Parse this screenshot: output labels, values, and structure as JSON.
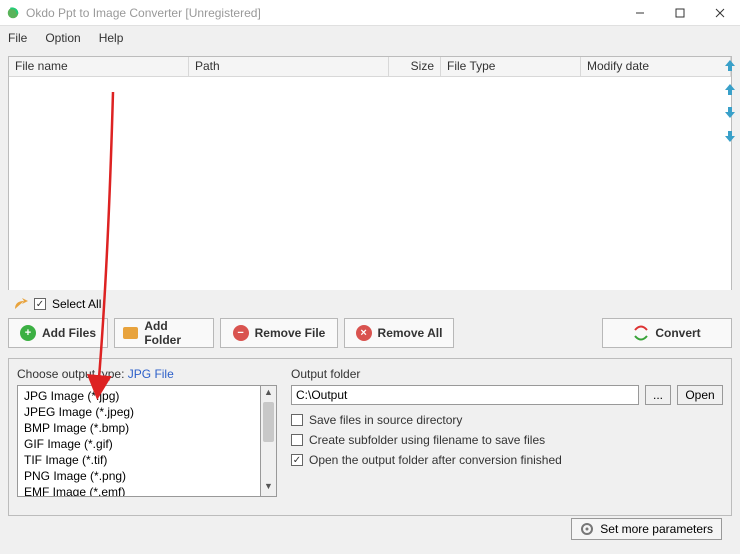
{
  "window": {
    "title": "Okdo Ppt to Image Converter [Unregistered]"
  },
  "menu": {
    "file": "File",
    "option": "Option",
    "help": "Help"
  },
  "table": {
    "cols": {
      "filename": "File name",
      "path": "Path",
      "size": "Size",
      "filetype": "File Type",
      "modify": "Modify date"
    }
  },
  "selectall": "Select All",
  "buttons": {
    "addfiles": "Add Files",
    "addfolder": "Add Folder",
    "removefile": "Remove File",
    "removeall": "Remove All",
    "convert": "Convert"
  },
  "output": {
    "choose_label": "Choose output type:",
    "choose_value": "JPG File",
    "types": [
      "JPG Image (*.jpg)",
      "JPEG Image (*.jpeg)",
      "BMP Image (*.bmp)",
      "GIF Image (*.gif)",
      "TIF Image (*.tif)",
      "PNG Image (*.png)",
      "EMF Image (*.emf)"
    ],
    "folder_label": "Output folder",
    "folder_value": "C:\\Output",
    "browse": "...",
    "open": "Open",
    "chk_save_src": "Save files in source directory",
    "chk_subfolder": "Create subfolder using filename to save files",
    "chk_open_after": "Open the output folder after conversion finished",
    "setmore": "Set more parameters"
  }
}
